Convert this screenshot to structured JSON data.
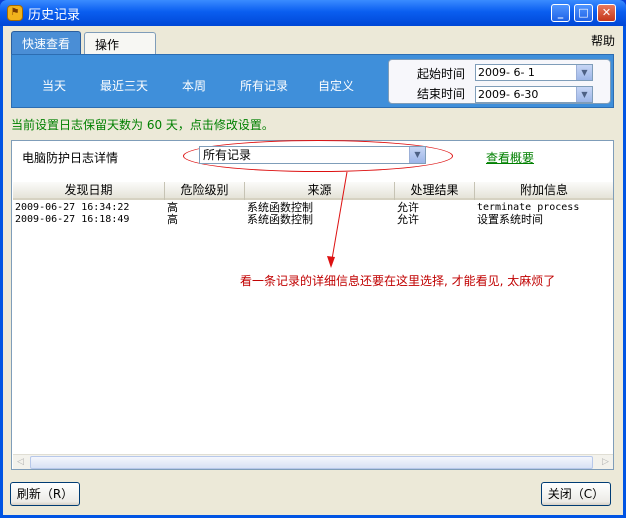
{
  "window": {
    "title": "历史记录",
    "minimize": "_",
    "maximize": "□",
    "close": "✕"
  },
  "tabs": [
    {
      "label": "快速查看"
    },
    {
      "label": "操作"
    }
  ],
  "help": "帮助",
  "quick_filters": [
    "当天",
    "最近三天",
    "本周",
    "所有记录",
    "自定义"
  ],
  "date_range": {
    "start_label": "起始时间",
    "start_value": "2009- 6- 1",
    "end_label": "结束时间",
    "end_value": "2009- 6-30"
  },
  "notice": "当前设置日志保留天数为 60 天，点击修改设置。",
  "detail": {
    "label": "电脑防护日志详情",
    "select_value": "所有记录",
    "summary_link": "查看概要"
  },
  "table": {
    "columns": [
      "发现日期",
      "危险级别",
      "来源",
      "处理结果",
      "附加信息"
    ],
    "rows": [
      [
        "2009-06-27 16:34:22",
        "高",
        "系统函数控制",
        "允许",
        "terminate process"
      ],
      [
        "2009-06-27 16:18:49",
        "高",
        "系统函数控制",
        "允许",
        "设置系统时间"
      ]
    ]
  },
  "annotation": "看一条记录的详细信息还要在这里选择, 才能看见, 太麻烦了",
  "buttons": {
    "refresh": "刷新（R）",
    "close": "关闭（C）"
  },
  "colors": {
    "annotation": "#c00000",
    "notice": "#008000",
    "panel": "#3f8fda"
  }
}
